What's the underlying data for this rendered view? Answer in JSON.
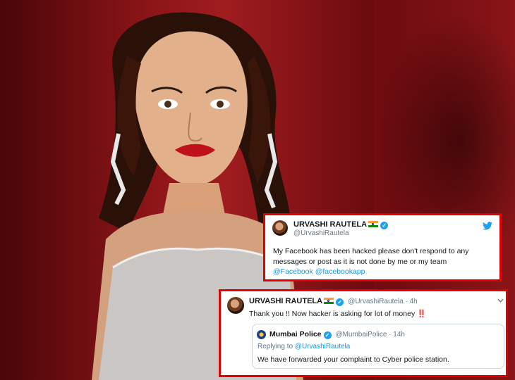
{
  "tweet1": {
    "name": "URVASHI RAUTELA",
    "handle": "@UrvashiRautela",
    "text": "My Facebook has been hacked please don't respond to any messages or post as it is not done by me or my team",
    "mentions": "@Facebook @facebookapp"
  },
  "tweet2": {
    "name": "URVASHI RAUTELA",
    "handle_time": "@UrvashiRautela · 4h",
    "text": "Thank you !! Now hacker is asking for lot of money",
    "emoji": "‼️",
    "quote": {
      "name": "Mumbai Police",
      "handle_time": "@MumbaiPolice · 14h",
      "replying_prefix": "Replying to ",
      "replying_to": "@UrvashiRautela",
      "text": "We have forwarded your complaint to Cyber police station."
    }
  },
  "icons": {
    "twitter": "twitter-bird-icon",
    "more": "chevron-down-icon",
    "verified": "verified-badge-icon",
    "flag": "india-flag-icon"
  },
  "colors": {
    "border": "#e10000",
    "link": "#1b95e0",
    "verified": "#1da1f2"
  }
}
